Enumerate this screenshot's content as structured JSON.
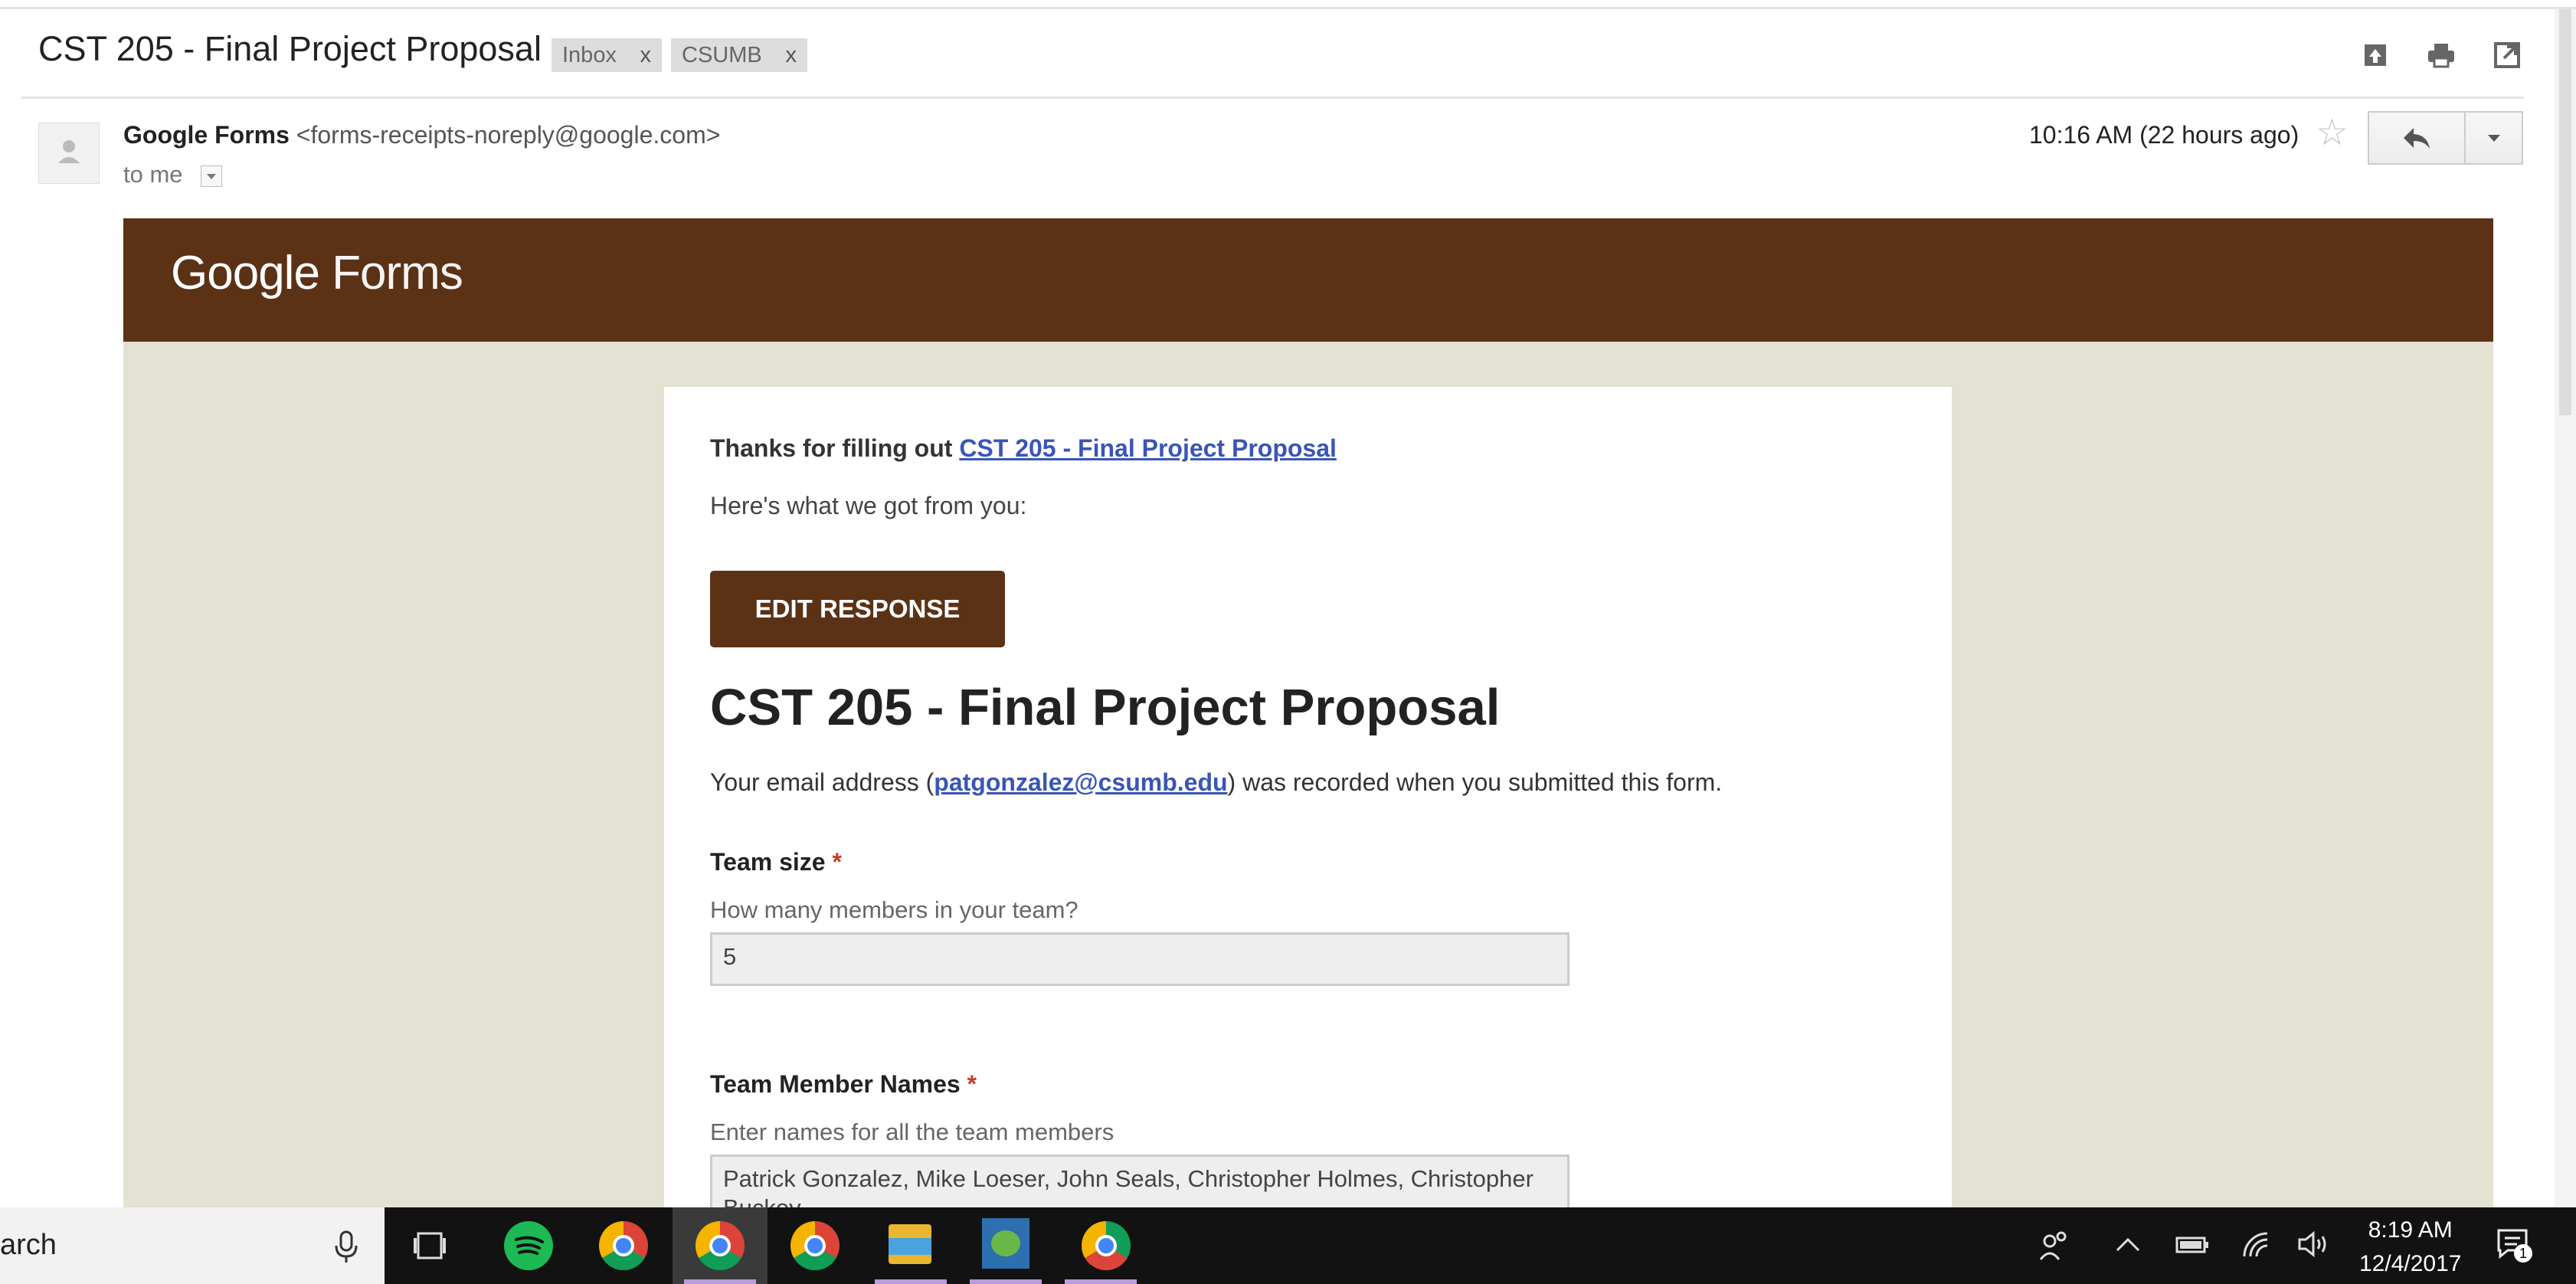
{
  "email": {
    "subject": "CST 205 - Final Project Proposal",
    "labels": [
      {
        "name": "Inbox",
        "remove": "x"
      },
      {
        "name": "CSUMB",
        "remove": "x"
      }
    ],
    "header_icons": [
      "archive-icon",
      "print-icon",
      "new-window-icon"
    ],
    "sender_name": "Google Forms",
    "sender_address": "<forms-receipts-noreply@google.com>",
    "recipient": "to me",
    "timestamp": "10:16 AM (22 hours ago)"
  },
  "body": {
    "brand": "Google",
    "brand_product": "Forms",
    "thanks_prefix": "Thanks for filling out ",
    "thanks_link": "CST 205 - Final Project Proposal",
    "got_text": "Here's what we got from you:",
    "edit_button": "EDIT RESPONSE",
    "form_title": "CST 205 - Final Project Proposal",
    "email_note_prefix": "Your email address (",
    "email_note_address": "patgonzalez@csumb.edu",
    "email_note_suffix": ") was recorded when you submitted this form.",
    "questions": [
      {
        "label": "Team size",
        "required": "*",
        "help": "How many members in your team?",
        "answer": "5"
      },
      {
        "label": "Team Member Names",
        "required": "*",
        "help": "Enter names for all the team members",
        "answer": "Patrick Gonzalez, Mike Loeser, John Seals, Christopher Holmes, Christopher Buckey"
      }
    ]
  },
  "taskbar": {
    "search_text": "arch",
    "time": "8:19 AM",
    "date": "12/4/2017",
    "notification_count": "1",
    "colors": {
      "spotify": "#1db954",
      "chrome_red": "#db4437",
      "chrome_yellow": "#f4b400",
      "chrome_green": "#0f9d58",
      "chrome_blue": "#4285f4"
    }
  },
  "colors": {
    "banner": "#5b3216",
    "page_bg": "#e3e2d3",
    "link": "#3a55b8",
    "required": "#c43b2b"
  }
}
